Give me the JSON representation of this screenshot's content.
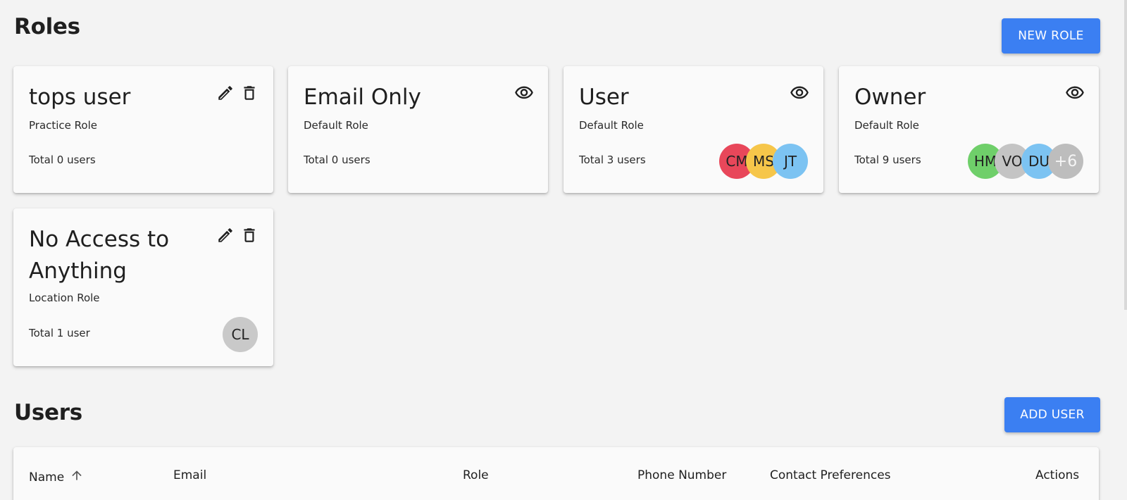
{
  "roles_section": {
    "title": "Roles",
    "new_role_label": "NEW ROLE"
  },
  "roles": [
    {
      "name": "tops user",
      "type": "Practice Role",
      "total": "Total 0 users",
      "actions": [
        "pencil-icon",
        "trash-icon"
      ],
      "avatars": []
    },
    {
      "name": "Email Only",
      "type": "Default Role",
      "total": "Total 0 users",
      "actions": [
        "eye-icon"
      ],
      "avatars": []
    },
    {
      "name": "User",
      "type": "Default Role",
      "total": "Total 3 users",
      "actions": [
        "eye-icon"
      ],
      "avatars": [
        {
          "initials": "CM",
          "color": "#e8475a"
        },
        {
          "initials": "MS",
          "color": "#f6c64a"
        },
        {
          "initials": "JT",
          "color": "#7cc3f2"
        }
      ]
    },
    {
      "name": "Owner",
      "type": "Default Role",
      "total": "Total 9 users",
      "actions": [
        "eye-icon"
      ],
      "avatars": [
        {
          "initials": "HM",
          "color": "#6fcf6a"
        },
        {
          "initials": "VO",
          "color": "#c4c4c4"
        },
        {
          "initials": "DU",
          "color": "#7cc3f2"
        },
        {
          "initials": "+6",
          "color": "#bdbdbd"
        }
      ]
    },
    {
      "name": "No Access to Anything",
      "type": "Location Role",
      "total": "Total 1 user",
      "actions": [
        "pencil-icon",
        "trash-icon"
      ],
      "avatars": [
        {
          "initials": "CL",
          "color": "#c9c9c9"
        }
      ]
    }
  ],
  "users_section": {
    "title": "Users",
    "add_user_label": "ADD USER"
  },
  "table": {
    "columns": [
      {
        "label": "Name",
        "sort": "ascending"
      },
      {
        "label": "Email"
      },
      {
        "label": "Role"
      },
      {
        "label": "Phone Number"
      },
      {
        "label": "Contact Preferences"
      },
      {
        "label": "Actions"
      }
    ]
  },
  "colors": {
    "accent": "#3b7ff2",
    "background": "#f3f3f3",
    "card": "#fafafa"
  }
}
